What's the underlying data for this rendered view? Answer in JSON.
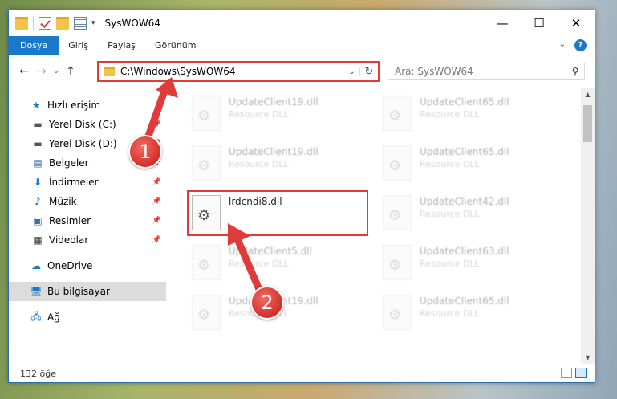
{
  "window": {
    "title": "SysWOW64",
    "controls": {
      "minimize": "—",
      "maximize": "☐",
      "close": "✕"
    }
  },
  "ribbon": {
    "tabs": [
      "Dosya",
      "Giriş",
      "Paylaş",
      "Görünüm"
    ],
    "help": "?"
  },
  "address": {
    "path": "C:\\Windows\\SysWOW64",
    "search_placeholder": "Ara: SysWOW64"
  },
  "nav_pane": {
    "quick_access": "Hızlı erişim",
    "items": [
      {
        "label": "Yerel Disk (C:)",
        "icon": "drive-icon"
      },
      {
        "label": "Yerel Disk (D:)",
        "icon": "drive-icon"
      },
      {
        "label": "Belgeler",
        "icon": "documents-icon"
      },
      {
        "label": "İndirmeler",
        "icon": "download-icon"
      },
      {
        "label": "Müzik",
        "icon": "music-icon"
      },
      {
        "label": "Resimler",
        "icon": "pictures-icon"
      },
      {
        "label": "Videolar",
        "icon": "videos-icon"
      }
    ],
    "onedrive": "OneDrive",
    "this_pc": "Bu bilgisayar",
    "network": "Ağ"
  },
  "files": {
    "left_column": [
      {
        "name": "UpdateClient19.dll",
        "desc": "Resource DLL"
      },
      {
        "name": "UpdateClient19.dll",
        "desc": "Resource DLL"
      },
      {
        "name": "lrdcndi8.dll",
        "desc": ""
      },
      {
        "name": "UpdateClient5.dll",
        "desc": "Resource DLL"
      },
      {
        "name": "UpdateClient19.dll",
        "desc": "Resource DLL"
      }
    ],
    "right_column": [
      {
        "name": "UpdateClient65.dll",
        "desc": "Resource DLL"
      },
      {
        "name": "UpdateClient65.dll",
        "desc": "Resource DLL"
      },
      {
        "name": "UpdateClient42.dll",
        "desc": "Resource DLL"
      },
      {
        "name": "UpdateClient63.dll",
        "desc": "Resource DLL"
      },
      {
        "name": "UpdateClient65.dll",
        "desc": "Resource DLL"
      }
    ]
  },
  "status": {
    "count": "132 öğe"
  },
  "annotations": {
    "badge1": "1",
    "badge2": "2",
    "color": "#e03b3b"
  }
}
